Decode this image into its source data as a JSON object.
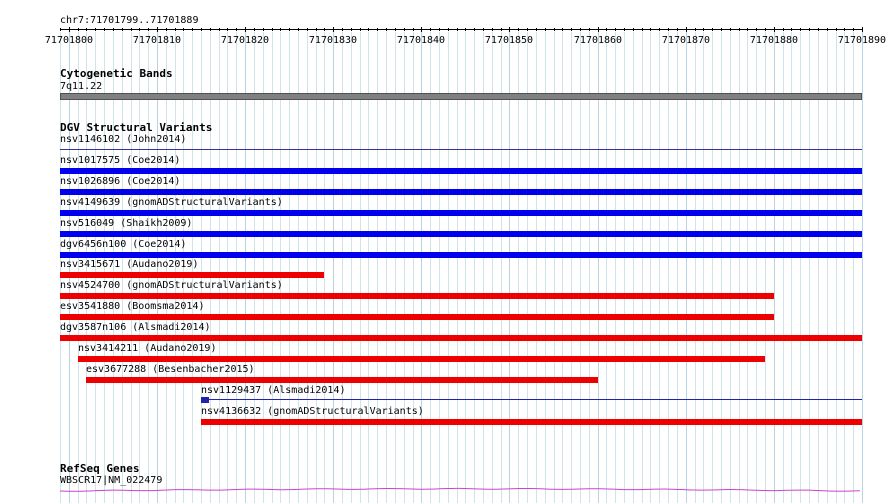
{
  "ruler": {
    "location": "chr7:71701799..71701889",
    "start": 71701799,
    "end": 71701890,
    "tick_labels": [
      "71701800",
      "71701810",
      "71701820",
      "71701830",
      "71701840",
      "71701850",
      "71701860",
      "71701870",
      "71701880",
      "71701890"
    ]
  },
  "cytoband": {
    "title": "Cytogenetic Bands",
    "band": "7q11.22",
    "band_color": "#808080"
  },
  "dgv": {
    "title": "DGV Structural Variants",
    "colors": {
      "gain": "#0000ee",
      "loss": "#ee0000",
      "complex": "#2222aa"
    },
    "features": [
      {
        "label": "nsv1146102 (John2014)",
        "start": 71701799,
        "end": 71701890,
        "kind": "line"
      },
      {
        "label": "nsv1017575 (Coe2014)",
        "start": 71701799,
        "end": 71701890,
        "kind": "gain"
      },
      {
        "label": "nsv1026896 (Coe2014)",
        "start": 71701799,
        "end": 71701890,
        "kind": "gain"
      },
      {
        "label": "nsv4149639 (gnomADStructuralVariants)",
        "start": 71701799,
        "end": 71701890,
        "kind": "gain"
      },
      {
        "label": "nsv516049 (Shaikh2009)",
        "start": 71701799,
        "end": 71701890,
        "kind": "gain"
      },
      {
        "label": "dgv6456n100 (Coe2014)",
        "start": 71701799,
        "end": 71701890,
        "kind": "gain"
      },
      {
        "label": "nsv3415671 (Audano2019)",
        "start": 71701799,
        "end": 71701829,
        "kind": "loss"
      },
      {
        "label": "nsv4524700 (gnomADStructuralVariants)",
        "start": 71701799,
        "end": 71701880,
        "kind": "loss"
      },
      {
        "label": "esv3541880 (Boomsma2014)",
        "start": 71701799,
        "end": 71701880,
        "kind": "loss"
      },
      {
        "label": "dgv3587n106 (Alsmadi2014)",
        "start": 71701799,
        "end": 71701890,
        "kind": "loss"
      },
      {
        "label": "nsv3414211 (Audano2019)",
        "start": 71701801,
        "end": 71701879,
        "kind": "loss"
      },
      {
        "label": "esv3677288 (Besenbacher2015)",
        "start": 71701802,
        "end": 71701860,
        "kind": "loss"
      },
      {
        "label": "nsv1129437 (Alsmadi2014)",
        "start": 71701815,
        "end": 71701890,
        "kind": "complex"
      },
      {
        "label": "nsv4136632 (gnomADStructuralVariants)",
        "start": 71701815,
        "end": 71701890,
        "kind": "loss"
      }
    ]
  },
  "refseq": {
    "title": "RefSeq Genes",
    "gene_label": "WBSCR17|NM_022479",
    "gene_color": "#cc44cc"
  }
}
